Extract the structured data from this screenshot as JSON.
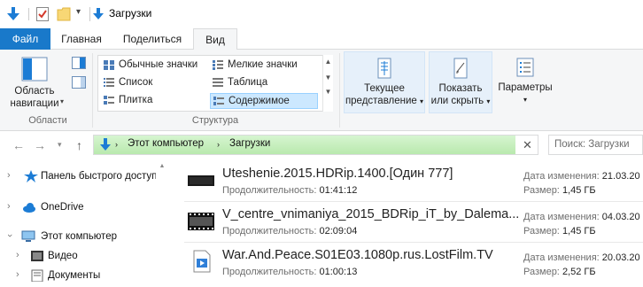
{
  "window": {
    "title": "Загрузки"
  },
  "ribbon_tabs": {
    "file": "Файл",
    "home": "Главная",
    "share": "Поделиться",
    "view": "Вид"
  },
  "ribbon": {
    "panes": {
      "nav_pane_label_1": "Область",
      "nav_pane_label_2": "навигации",
      "group_label": "Области"
    },
    "layout": {
      "group_label": "Структура",
      "items": [
        {
          "label": "Обычные значки"
        },
        {
          "label": "Мелкие значки"
        },
        {
          "label": "Список"
        },
        {
          "label": "Таблица"
        },
        {
          "label": "Плитка"
        },
        {
          "label": "Содержимое",
          "selected": true
        }
      ]
    },
    "current_view": {
      "line1": "Текущее",
      "line2": "представление"
    },
    "show_hide": {
      "line1": "Показать",
      "line2": "или скрыть"
    },
    "options": {
      "label": "Параметры"
    }
  },
  "address": {
    "crumbs": [
      "Этот компьютер",
      "Загрузки"
    ],
    "search_placeholder": "Поиск: Загрузки"
  },
  "nav_tree": [
    {
      "label": "Панель быстрого доступа",
      "icon": "star-icon"
    },
    {
      "label": "OneDrive",
      "icon": "cloud-icon"
    },
    {
      "label": "Этот компьютер",
      "icon": "computer-icon",
      "expanded": true
    },
    {
      "label": "Видео",
      "icon": "video-folder-icon"
    },
    {
      "label": "Документы",
      "icon": "documents-folder-icon"
    }
  ],
  "files": [
    {
      "name": "Uteshenie.2015.HDRip.1400.[Один 777]",
      "duration_label": "Продолжительность:",
      "duration": "01:41:12",
      "date_label": "Дата изменения:",
      "date": "21.03.20",
      "size_label": "Размер:",
      "size": "1,45 ГБ"
    },
    {
      "name": "V_centre_vnimaniya_2015_BDRip_iT_by_Dalema...",
      "duration_label": "Продолжительность:",
      "duration": "02:09:04",
      "date_label": "Дата изменения:",
      "date": "04.03.20",
      "size_label": "Размер:",
      "size": "1,45 ГБ"
    },
    {
      "name": "War.And.Peace.S01E03.1080p.rus.LostFilm.TV",
      "duration_label": "Продолжительность:",
      "duration": "01:00:13",
      "date_label": "Дата изменения:",
      "date": "20.03.20",
      "size_label": "Размер:",
      "size": "2,52 ГБ"
    }
  ],
  "colors": {
    "file_tab": "#1979ca",
    "address_green": "#b9e9ae",
    "selection": "#cce8ff"
  }
}
